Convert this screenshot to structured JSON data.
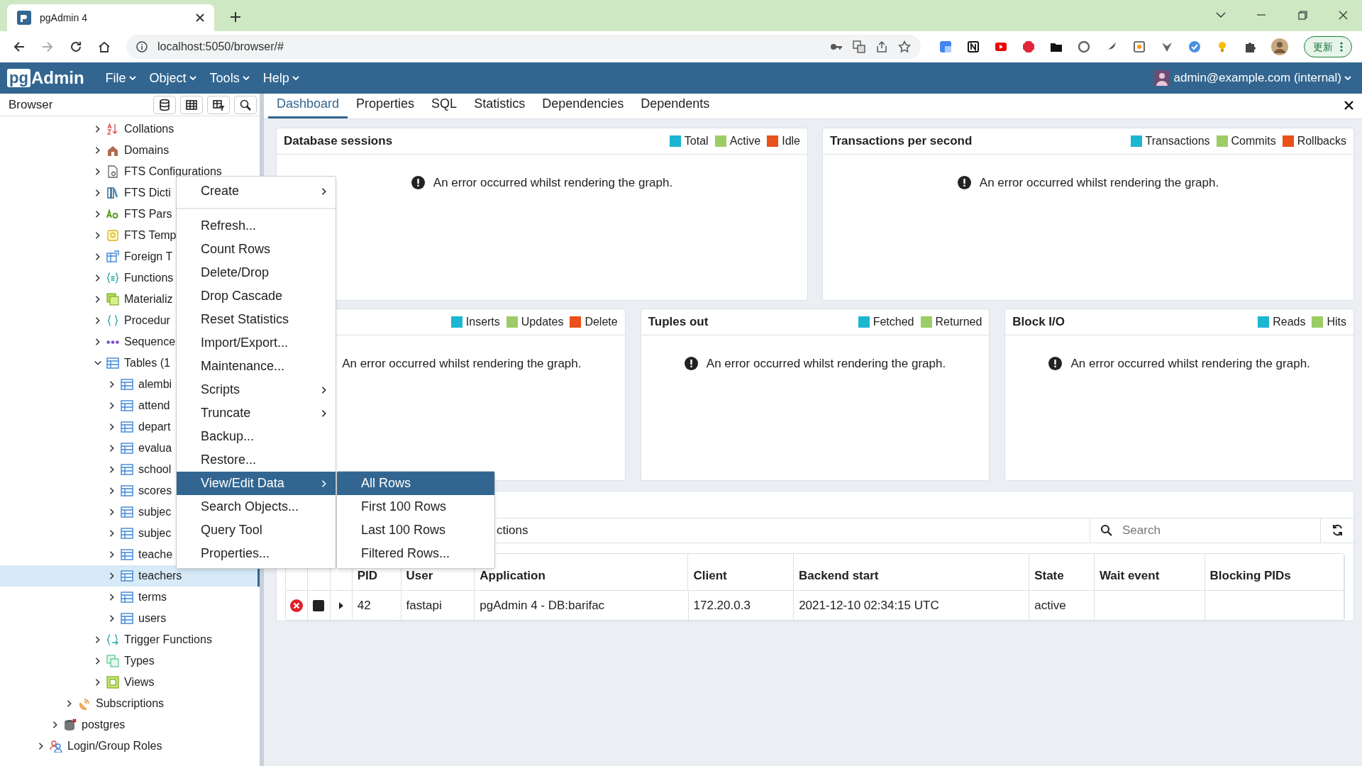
{
  "browser": {
    "tab_title": "pgAdmin 4",
    "url": "localhost:5050/browser/#",
    "update_button": "更新"
  },
  "app": {
    "logo_box": "pg",
    "logo_text": "Admin",
    "menus": [
      "File",
      "Object",
      "Tools",
      "Help"
    ],
    "user": "admin@example.com (internal)"
  },
  "browser_panel": {
    "title": "Browser"
  },
  "tree": {
    "schema_objects": [
      {
        "label": "Collations",
        "kind": "collation",
        "expanded": false,
        "selected": false
      },
      {
        "label": "Domains",
        "kind": "domain",
        "expanded": false,
        "selected": false
      },
      {
        "label": "FTS Configurations",
        "kind": "fts-config",
        "expanded": false,
        "selected": false
      },
      {
        "label": "FTS Dicti",
        "kind": "fts-dict",
        "expanded": false,
        "selected": false
      },
      {
        "label": "FTS Pars",
        "kind": "fts-parser",
        "expanded": false,
        "selected": false
      },
      {
        "label": "FTS Temp",
        "kind": "fts-template",
        "expanded": false,
        "selected": false
      },
      {
        "label": "Foreign T",
        "kind": "foreign-table",
        "expanded": false,
        "selected": false
      },
      {
        "label": "Functions",
        "kind": "function",
        "expanded": false,
        "selected": false
      },
      {
        "label": "Materializ",
        "kind": "matview",
        "expanded": false,
        "selected": false
      },
      {
        "label": "Procedur",
        "kind": "procedure",
        "expanded": false,
        "selected": false
      },
      {
        "label": "Sequence",
        "kind": "sequence",
        "expanded": false,
        "selected": false
      },
      {
        "label": "Tables (1",
        "kind": "tables",
        "expanded": true,
        "selected": false,
        "children": [
          {
            "label": "alembi",
            "kind": "table",
            "expanded": false,
            "selected": false
          },
          {
            "label": "attend",
            "kind": "table",
            "expanded": false,
            "selected": false
          },
          {
            "label": "depart",
            "kind": "table",
            "expanded": false,
            "selected": false
          },
          {
            "label": "evalua",
            "kind": "table",
            "expanded": false,
            "selected": false
          },
          {
            "label": "school",
            "kind": "table",
            "expanded": false,
            "selected": false
          },
          {
            "label": "scores",
            "kind": "table",
            "expanded": false,
            "selected": false
          },
          {
            "label": "subjec",
            "kind": "table",
            "expanded": false,
            "selected": false
          },
          {
            "label": "subjec",
            "kind": "table",
            "expanded": false,
            "selected": false
          },
          {
            "label": "teache",
            "kind": "table",
            "expanded": false,
            "selected": false
          },
          {
            "label": "teachers",
            "kind": "table",
            "expanded": false,
            "selected": true
          },
          {
            "label": "terms",
            "kind": "table",
            "expanded": false,
            "selected": false
          },
          {
            "label": "users",
            "kind": "table",
            "expanded": false,
            "selected": false
          }
        ]
      },
      {
        "label": "Trigger Functions",
        "kind": "trigger-function",
        "expanded": false,
        "selected": false
      },
      {
        "label": "Types",
        "kind": "type",
        "expanded": false,
        "selected": false
      },
      {
        "label": "Views",
        "kind": "view",
        "expanded": false,
        "selected": false
      }
    ],
    "database_objects": [
      {
        "label": "Subscriptions",
        "kind": "subscription",
        "expanded": false,
        "selected": false
      }
    ],
    "databases": [
      {
        "label": "postgres",
        "kind": "database",
        "expanded": false,
        "selected": false
      }
    ],
    "server_objects": [
      {
        "label": "Login/Group Roles",
        "kind": "roles",
        "expanded": false,
        "selected": false
      }
    ]
  },
  "tabs": [
    {
      "label": "Dashboard",
      "selected": true
    },
    {
      "label": "Properties",
      "selected": false
    },
    {
      "label": "SQL",
      "selected": false
    },
    {
      "label": "Statistics",
      "selected": false
    },
    {
      "label": "Dependencies",
      "selected": false
    },
    {
      "label": "Dependents",
      "selected": false
    }
  ],
  "dashboard": {
    "graph_rows": [
      [
        {
          "title": "Database sessions",
          "legend": [
            {
              "label": "Total",
              "color": "#1cb6d3"
            },
            {
              "label": "Active",
              "color": "#9ccc65"
            },
            {
              "label": "Idle",
              "color": "#ea5019"
            }
          ],
          "error": "An error occurred whilst rendering the graph.",
          "error_icon": true
        },
        {
          "title": "Transactions per second",
          "legend": [
            {
              "label": "Transactions",
              "color": "#1cb6d3"
            },
            {
              "label": "Commits",
              "color": "#9ccc65"
            },
            {
              "label": "Rollbacks",
              "color": "#ea5019"
            }
          ],
          "error": "An error occurred whilst rendering the graph.",
          "error_icon": true
        }
      ],
      [
        {
          "legend": [
            {
              "label": "Inserts",
              "color": "#1cb6d3"
            },
            {
              "label": "Updates",
              "color": "#9ccc65"
            },
            {
              "label": "Delete",
              "color": "#ea5019"
            }
          ],
          "error": "An error occurred whilst rendering the graph.",
          "error_icon": false
        },
        {
          "title": "Tuples out",
          "legend": [
            {
              "label": "Fetched",
              "color": "#1cb6d3"
            },
            {
              "label": "Returned",
              "color": "#9ccc65"
            }
          ],
          "error": "An error occurred whilst rendering the graph.",
          "error_icon": true
        },
        {
          "title": "Block I/O",
          "legend": [
            {
              "label": "Reads",
              "color": "#1cb6d3"
            },
            {
              "label": "Hits",
              "color": "#9ccc65"
            }
          ],
          "error": "An error occurred whilst rendering the graph.",
          "error_icon": true
        }
      ]
    ]
  },
  "server_activity": {
    "tab_fragment": "ctions",
    "search_placeholder": "Search",
    "columns": [
      "PID",
      "User",
      "Application",
      "Client",
      "Backend start",
      "State",
      "Wait event",
      "Blocking PIDs"
    ],
    "rows": [
      {
        "cells": [
          "42",
          "fastapi",
          "pgAdmin 4 - DB:barifac",
          "172.20.0.3",
          "2021-12-10 02:34:15 UTC",
          "active"
        ]
      }
    ]
  },
  "context_menu": {
    "items": [
      {
        "kind": "entry",
        "label": "Create",
        "submenu": true,
        "selected": false
      },
      {
        "kind": "divider"
      },
      {
        "kind": "entry",
        "label": "Refresh...",
        "submenu": false,
        "selected": false
      },
      {
        "kind": "entry",
        "label": "Count Rows",
        "submenu": false,
        "selected": false
      },
      {
        "kind": "entry",
        "label": "Delete/Drop",
        "submenu": false,
        "selected": false
      },
      {
        "kind": "entry",
        "label": "Drop Cascade",
        "submenu": false,
        "selected": false
      },
      {
        "kind": "entry",
        "label": "Reset Statistics",
        "submenu": false,
        "selected": false
      },
      {
        "kind": "entry",
        "label": "Import/Export...",
        "submenu": false,
        "selected": false
      },
      {
        "kind": "entry",
        "label": "Maintenance...",
        "submenu": false,
        "selected": false
      },
      {
        "kind": "entry",
        "label": "Scripts",
        "submenu": true,
        "selected": false
      },
      {
        "kind": "entry",
        "label": "Truncate",
        "submenu": true,
        "selected": false
      },
      {
        "kind": "entry",
        "label": "Backup...",
        "submenu": false,
        "selected": false
      },
      {
        "kind": "entry",
        "label": "Restore...",
        "submenu": false,
        "selected": false
      },
      {
        "kind": "entry",
        "label": "View/Edit Data",
        "submenu": true,
        "selected": true
      },
      {
        "kind": "entry",
        "label": "Search Objects...",
        "submenu": false,
        "selected": false
      },
      {
        "kind": "entry",
        "label": "Query Tool",
        "submenu": false,
        "selected": false
      },
      {
        "kind": "entry",
        "label": "Properties...",
        "submenu": false,
        "selected": false
      }
    ]
  },
  "submenu": {
    "items": [
      {
        "label": "All Rows",
        "selected": true
      },
      {
        "label": "First 100 Rows",
        "selected": false
      },
      {
        "label": "Last 100 Rows",
        "selected": false
      },
      {
        "label": "Filtered Rows...",
        "selected": false
      }
    ]
  }
}
